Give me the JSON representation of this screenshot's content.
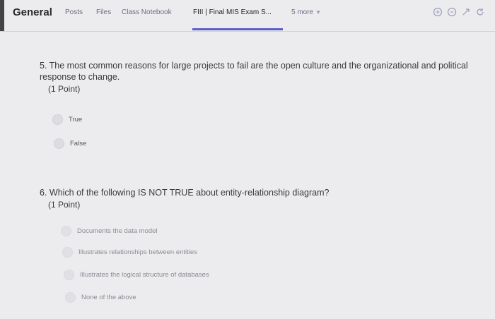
{
  "header": {
    "channel": "General",
    "tabs": [
      {
        "label": "Posts"
      },
      {
        "label": "Files"
      },
      {
        "label": "Class Notebook"
      },
      {
        "label": "FIII | Final MIS Exam S..."
      },
      {
        "label": "5 more"
      }
    ],
    "icons": [
      "reply-icon",
      "expand-icon",
      "popout-icon",
      "refresh-icon"
    ]
  },
  "questions": [
    {
      "text": "5. The most common reasons for large projects to fail are the open culture and the organizational and political response to change.",
      "points": "(1 Point)",
      "options": [
        "True",
        "False"
      ]
    },
    {
      "text": "6. Which of the following IS NOT TRUE about entity-relationship diagram?",
      "points": "(1 Point)",
      "options": [
        "Documents the data model",
        "Illustrates relationships between entities",
        "Illustrates the logical structure of databases",
        "None of the above"
      ]
    }
  ],
  "colors": {
    "accent": "#5b5fc7",
    "background": "#ececee"
  }
}
